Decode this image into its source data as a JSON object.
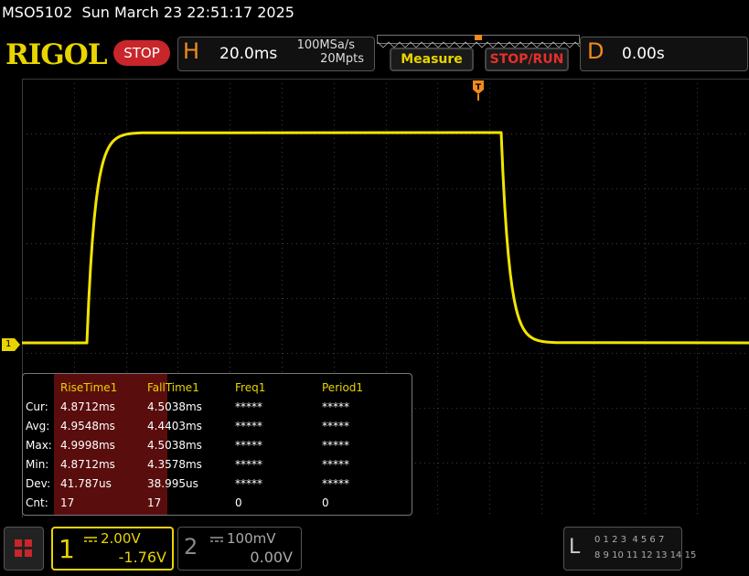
{
  "title_line": "MSO5102  Sun March 23 22:51:17 2025",
  "brand": "RIGOL",
  "run_state": "STOP",
  "horizontal": {
    "label": "H",
    "timebase": "20.0ms",
    "sample_rate": "100MSa/s",
    "memory_depth": "20Mpts"
  },
  "buttons": {
    "measure": "Measure",
    "stop_run": "STOP/RUN"
  },
  "delay": {
    "label": "D",
    "value": "0.00s"
  },
  "channel1_marker": "1",
  "measurements": {
    "columns": [
      "RiseTime1",
      "FallTime1",
      "Freq1",
      "Period1"
    ],
    "rows": [
      {
        "label": "Cur:",
        "values": [
          "4.8712ms",
          "4.5038ms",
          "*****",
          "*****"
        ]
      },
      {
        "label": "Avg:",
        "values": [
          "4.9548ms",
          "4.4403ms",
          "*****",
          "*****"
        ]
      },
      {
        "label": "Max:",
        "values": [
          "4.9998ms",
          "4.5038ms",
          "*****",
          "*****"
        ]
      },
      {
        "label": "Min:",
        "values": [
          "4.8712ms",
          "4.3578ms",
          "*****",
          "*****"
        ]
      },
      {
        "label": "Dev:",
        "values": [
          "41.787us",
          "38.995us",
          "*****",
          "*****"
        ]
      },
      {
        "label": "Cnt:",
        "values": [
          "17",
          "17",
          "0",
          "0"
        ]
      }
    ]
  },
  "channel1": {
    "number": "1",
    "scale": "2.00V",
    "offset": "-1.76V",
    "color": "#e8d400"
  },
  "channel2": {
    "number": "2",
    "scale": "100mV",
    "offset": "0.00V",
    "color": "#888888"
  },
  "logic": {
    "label": "L",
    "row1": "0 1 2 3  4 5 6 7",
    "row2": "8 9 10 11 12 13 14 15"
  },
  "colors": {
    "accent": "#e8d400",
    "horizontal_accent": "#f08a1c",
    "stop": "#c8262a",
    "measure_highlight": "#5a0d0d"
  },
  "icons": [
    "menu-icon",
    "trigger-position-icon",
    "coupling-icon"
  ]
}
